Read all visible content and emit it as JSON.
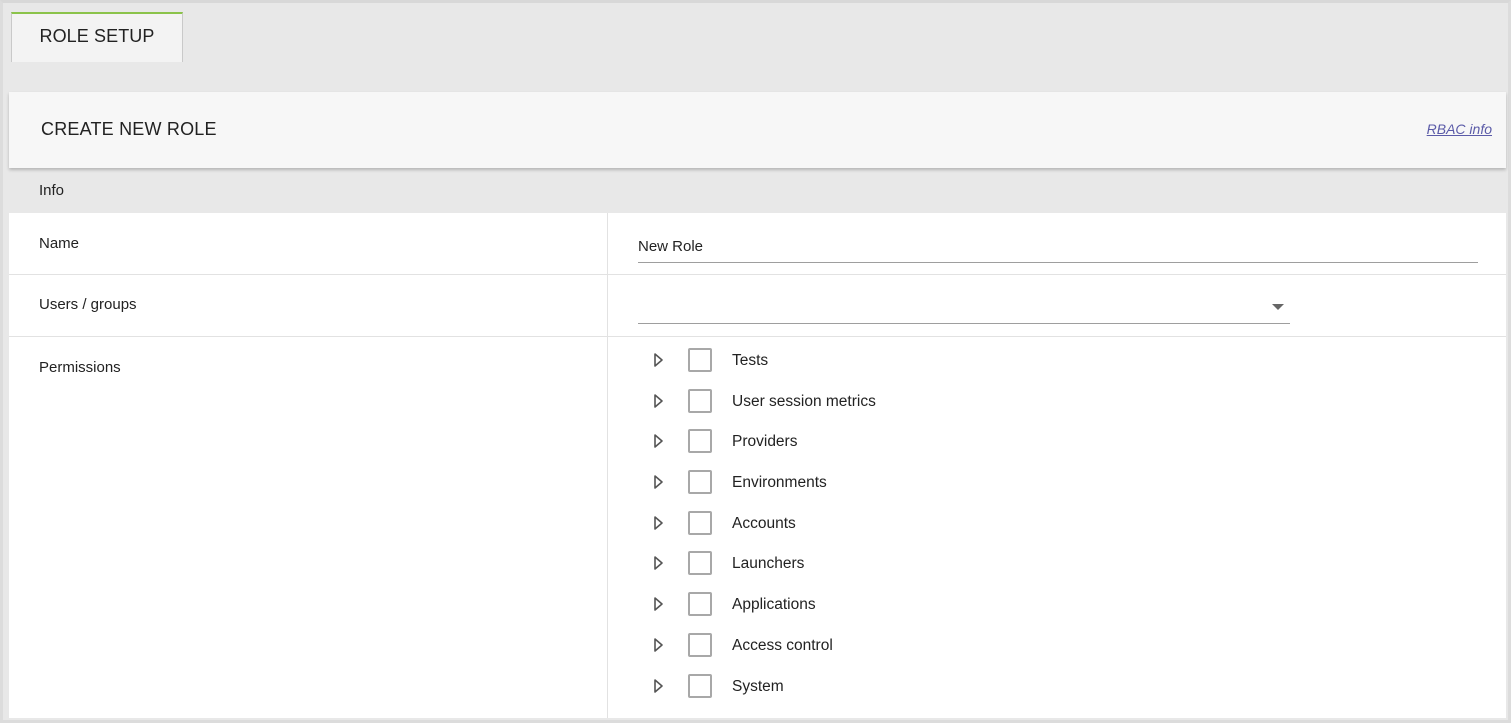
{
  "tabs": [
    {
      "label": "ROLE SETUP"
    }
  ],
  "card": {
    "title": "CREATE NEW ROLE",
    "rbac_link": "RBAC info"
  },
  "section": {
    "label": "Info"
  },
  "fields": {
    "name": {
      "label": "Name",
      "value": "New Role"
    },
    "users_groups": {
      "label": "Users / groups",
      "value": ""
    },
    "permissions": {
      "label": "Permissions"
    }
  },
  "permissions": [
    {
      "label": "Tests",
      "checked": false
    },
    {
      "label": "User session metrics",
      "checked": false
    },
    {
      "label": "Providers",
      "checked": false
    },
    {
      "label": "Environments",
      "checked": false
    },
    {
      "label": "Accounts",
      "checked": false
    },
    {
      "label": "Launchers",
      "checked": false
    },
    {
      "label": "Applications",
      "checked": false
    },
    {
      "label": "Access control",
      "checked": false
    },
    {
      "label": "System",
      "checked": false
    }
  ],
  "colors": {
    "tab_accent": "#8bc34a",
    "link": "#5b5ba8",
    "background": "#e8e8e8"
  }
}
